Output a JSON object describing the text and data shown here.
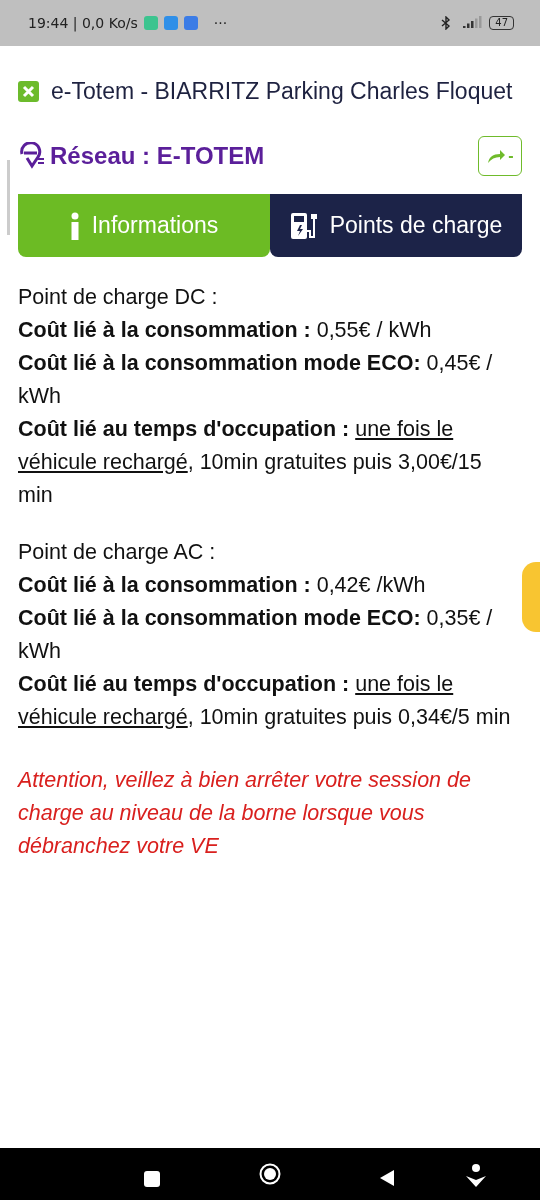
{
  "status_bar": {
    "time": "19:44 | 0,0 Ko/s",
    "dots": "···",
    "battery": "47"
  },
  "header": {
    "title": "e-Totem - BIARRITZ Parking Charles Floquet"
  },
  "network": {
    "label": "Réseau : E-TOTEM",
    "share_label": "-"
  },
  "tabs": [
    {
      "label": "Informations",
      "selected": true,
      "kind": "info"
    },
    {
      "label": "Points de charge",
      "selected": false,
      "kind": "charger"
    }
  ],
  "sections": [
    {
      "heading": "Point de charge DC :",
      "lines": [
        {
          "label": "Coût lié à la consommation :",
          "value": "0,55€ / kWh"
        },
        {
          "label": "Coût lié à la consommation mode ECO:",
          "value": "0,45€ / kWh"
        },
        {
          "label": "Coût lié au temps d'occupation :",
          "underlined": "une fois le véhicule rechargé",
          "value": ", 10min gratuites puis 3,00€/15 min"
        }
      ]
    },
    {
      "heading": "Point de charge AC :",
      "lines": [
        {
          "label": "Coût lié à la consommation :",
          "value": "0,42€ /kWh"
        },
        {
          "label": "Coût lié à la consommation mode ECO:",
          "value": "0,35€ / kWh"
        },
        {
          "label": "Coût lié au temps d'occupation :",
          "underlined": "une fois le véhicule rechargé",
          "value": ", 10min gratuites puis 0,34€/5 min"
        }
      ]
    }
  ],
  "warning": "Attention, veillez à bien arrêter votre session de charge au niveau de la borne lorsque vous débranchez votre VE"
}
